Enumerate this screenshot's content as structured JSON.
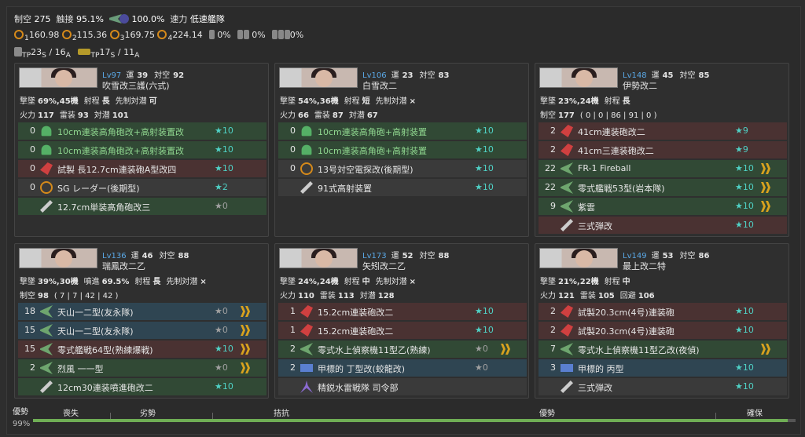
{
  "header": {
    "seiku_label": "制空",
    "seiku_value": "275",
    "sakuteki_label": "触接",
    "sakuteki_value": "95.1%",
    "contact_value": "100.0%",
    "speed_label": "速力",
    "speed_value": "低速艦隊",
    "los": [
      {
        "index": "1",
        "value": "160.98"
      },
      {
        "index": "2",
        "value": "115.36"
      },
      {
        "index": "3",
        "value": "169.75"
      },
      {
        "index": "4",
        "value": "224.14"
      }
    ],
    "drum_values": [
      "0%",
      "0%",
      "0%"
    ],
    "tp_label": "TP",
    "tp_s": "23",
    "tp_s_sub": "S",
    "tp_a": "16",
    "tp_a_sub": "A",
    "tp2_s": "17",
    "tp2_s_sub": "S",
    "tp2_a": "11",
    "tp2_a_sub": "A",
    "slash": "/"
  },
  "labels": {
    "luck": "運",
    "aa": "対空",
    "evade_mark": "撃墜",
    "range": "射程",
    "oasw": "先制対潜",
    "fp": "火力",
    "torp": "雷装",
    "asw": "対潜",
    "seiku": "制空",
    "eva": "回避",
    "baku": "噴進"
  },
  "ships": [
    {
      "lv": "Lv97",
      "luck": "39",
      "aa": "92",
      "name": "吹雪改三護(六式)",
      "shoot": "69%,45機",
      "range": "長",
      "oasw": "可",
      "fp": "117",
      "torp": "93",
      "asw": "101",
      "equip": [
        {
          "count": "0",
          "name": "10cm連装高角砲改+高射装置改",
          "star": "★10",
          "color": "green",
          "icon": "gun",
          "green_text": true
        },
        {
          "count": "0",
          "name": "10cm連装高角砲改+高射装置改",
          "star": "★10",
          "color": "green",
          "icon": "gun",
          "green_text": true
        },
        {
          "count": "0",
          "name": "試製 長12.7cm連装砲A型改四",
          "star": "★10",
          "color": "red",
          "icon": "red"
        },
        {
          "count": "0",
          "name": "SG レーダー(後期型)",
          "star": "★2",
          "color": "gray",
          "icon": "radar"
        },
        {
          "count": "",
          "name": "12.7cm単装高角砲改三",
          "star": "★0",
          "color": "green",
          "icon": "wrench",
          "grey_star": true
        }
      ]
    },
    {
      "lv": "Lv106",
      "luck": "23",
      "aa": "83",
      "name": "白雪改二",
      "shoot": "54%,36機",
      "range": "短",
      "oasw": "×",
      "fp": "66",
      "torp": "87",
      "asw": "67",
      "equip": [
        {
          "count": "0",
          "name": "10cm連装高角砲+高射装置",
          "star": "★10",
          "color": "green",
          "icon": "gun",
          "green_text": true
        },
        {
          "count": "0",
          "name": "10cm連装高角砲+高射装置",
          "star": "★10",
          "color": "green",
          "icon": "gun",
          "green_text": true
        },
        {
          "count": "0",
          "name": "13号対空電探改(後期型)",
          "star": "★10",
          "color": "gray",
          "icon": "radar"
        },
        {
          "count": "",
          "name": "91式高射装置",
          "star": "★10",
          "color": "gray",
          "icon": "wrench"
        }
      ]
    },
    {
      "lv": "Lv148",
      "luck": "45",
      "aa": "85",
      "name": "伊勢改二",
      "shoot": "23%,24機",
      "range": "長",
      "seiku": "177",
      "seiku_detail": "( 0 | 0 | 86 | 91 | 0 )",
      "equip": [
        {
          "count": "2",
          "name": "41cm連装砲改二",
          "star": "★9",
          "color": "red",
          "icon": "red"
        },
        {
          "count": "2",
          "name": "41cm三連装砲改二",
          "star": "★9",
          "color": "red",
          "icon": "red"
        },
        {
          "count": "22",
          "name": "FR-1 Fireball",
          "star": "★10",
          "color": "green",
          "icon": "plane-g",
          "chev": true
        },
        {
          "count": "22",
          "name": "零式艦戦53型(岩本隊)",
          "star": "★10",
          "color": "green",
          "icon": "plane-g",
          "chev": true
        },
        {
          "count": "9",
          "name": "紫雲",
          "star": "★10",
          "color": "green",
          "icon": "plane-g",
          "chev": true
        },
        {
          "count": "",
          "name": "三式弾改",
          "star": "★10",
          "color": "red",
          "icon": "wrench"
        }
      ]
    },
    {
      "lv": "Lv136",
      "luck": "46",
      "aa": "88",
      "name": "瑞鳳改二乙",
      "shoot": "39%,30機",
      "baku": "69.5%",
      "range": "長",
      "oasw": "×",
      "seiku": "98",
      "seiku_detail": "( 7 | 7 | 42 | 42 )",
      "equip": [
        {
          "count": "18",
          "name": "天山一二型(友永隊)",
          "star": "★0",
          "color": "blue",
          "icon": "plane-g",
          "chev": true,
          "grey_star": true
        },
        {
          "count": "15",
          "name": "天山一二型(友永隊)",
          "star": "★0",
          "color": "blue",
          "icon": "plane-g",
          "chev": true,
          "grey_star": true
        },
        {
          "count": "15",
          "name": "零式艦戦64型(熟練爆戦)",
          "star": "★10",
          "color": "red",
          "icon": "plane-g",
          "chev": true
        },
        {
          "count": "2",
          "name": "烈風 一一型",
          "star": "★0",
          "color": "green",
          "icon": "plane-g",
          "chev": true,
          "grey_star": true
        },
        {
          "count": "",
          "name": "12cm30連装噴進砲改二",
          "star": "★10",
          "color": "green",
          "icon": "wrench"
        }
      ]
    },
    {
      "lv": "Lv173",
      "luck": "52",
      "aa": "88",
      "name": "矢矧改二乙",
      "shoot": "24%,24機",
      "range": "中",
      "oasw": "×",
      "fp": "110",
      "torp": "113",
      "asw": "128",
      "equip": [
        {
          "count": "1",
          "name": "15.2cm連装砲改二",
          "star": "★10",
          "color": "red",
          "icon": "red"
        },
        {
          "count": "1",
          "name": "15.2cm連装砲改二",
          "star": "★10",
          "color": "red",
          "icon": "red"
        },
        {
          "count": "2",
          "name": "零式水上偵察機11型乙(熟練)",
          "star": "★0",
          "color": "green",
          "icon": "plane-g",
          "chev": true,
          "grey_star": true
        },
        {
          "count": "2",
          "name": "甲標的 丁型改(蛟龍改)",
          "star": "★0",
          "color": "blue",
          "icon": "torp",
          "grey_star": true
        },
        {
          "count": "",
          "name": "精鋭水雷戦隊 司令部",
          "star": "",
          "color": "gray",
          "icon": "fig"
        }
      ]
    },
    {
      "lv": "Lv149",
      "luck": "53",
      "aa": "86",
      "name": "最上改二特",
      "shoot": "21%,22機",
      "range": "中",
      "fp": "121",
      "torp": "105",
      "eva": "106",
      "equip": [
        {
          "count": "2",
          "name": "試製20.3cm(4号)連装砲",
          "star": "★10",
          "color": "red",
          "icon": "red"
        },
        {
          "count": "2",
          "name": "試製20.3cm(4号)連装砲",
          "star": "★10",
          "color": "red",
          "icon": "red"
        },
        {
          "count": "7",
          "name": "零式水上偵察機11型乙改(夜偵)",
          "star": "",
          "color": "green",
          "icon": "plane-g",
          "chev": true
        },
        {
          "count": "3",
          "name": "甲標的 丙型",
          "star": "★10",
          "color": "blue",
          "icon": "torp"
        },
        {
          "count": "",
          "name": "三式弾改",
          "star": "★10",
          "color": "gray",
          "icon": "wrench"
        }
      ]
    }
  ],
  "bar": {
    "title": "優勢",
    "percent": "99%",
    "fill_fraction": 0.99,
    "labels": [
      "喪失",
      "劣勢",
      "拮抗",
      "優勢",
      "確保"
    ]
  }
}
